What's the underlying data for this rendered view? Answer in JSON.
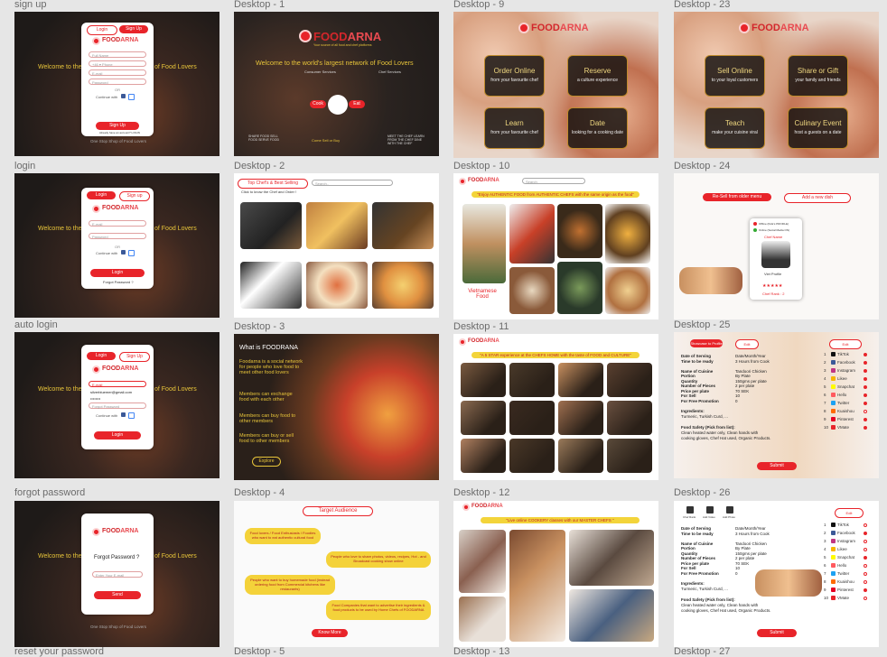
{
  "brand": {
    "name_a": "FOOD",
    "name_b": "ARNA",
    "tagline": "Your source of all food and chef platforms"
  },
  "colors": {
    "accent": "#e8242a",
    "gold": "#e8c53a",
    "canvas": "#e6e6e6"
  },
  "frames": {
    "signup": {
      "label": "sign up",
      "welcome": "Welcome to the",
      "welcome_r": "of Food Lovers",
      "tab_login": "Login",
      "tab_signup": "Sign Up",
      "full_name": "Full Name",
      "phone_code": "+46",
      "phone": "Phone",
      "email": "E-mail",
      "password": "Password",
      "or": "OR",
      "continue_with": "Continue with",
      "submit": "Sign Up",
      "footer": "Already have an account? LOGIN",
      "bottom": "One Stop Shop of Food Lovers"
    },
    "login": {
      "label": "login",
      "welcome": "Welcome to the",
      "welcome_r": "of Food Lovers",
      "tab_login": "Login",
      "tab_signup": "Sign up",
      "email": "E-mail",
      "password": "Password",
      "or": "OR",
      "continue_with": "Continue with",
      "submit": "Login",
      "forgot": "Forgot Password ?"
    },
    "autologin": {
      "label": "auto login",
      "welcome": "Welcome to the",
      "welcome_r": "of Food Lovers",
      "tab_login": "Login",
      "tab_signup": "Sign Up",
      "email_label": "E-mail",
      "email_value": "silverbluemer@gmail.com",
      "password_value": "••••••••",
      "forgot": "Forgot Password",
      "continue_with": "Continue with",
      "submit": "Login"
    },
    "forgot": {
      "label": "forgot password",
      "welcome": "Welcome to the",
      "welcome_r": "of Food Lovers",
      "title": "Forgot Password ?",
      "email": "Enter Your E-mail",
      "submit": "Send",
      "bottom": "One Stop Shop of Food Lovers",
      "next_label": "reset your password"
    },
    "d1": {
      "label": "Desktop - 1",
      "headline": "Welcome to the world's largest network of Food Lovers",
      "select": "Consumer Services",
      "select2": "Chef Services",
      "left_note": "SHARE FOOD SELL FOOD SERVE FOOD",
      "right_note": "MEET THE CHEF LEARN FROM THE CHEF DINE WITH THE CHEF",
      "center_note": "Come Sell or Buy",
      "left_btn": "Cook",
      "right_btn": "Eat"
    },
    "d2": {
      "label": "Desktop - 2",
      "chip": "Top Chef's & Best Selling",
      "search": "Search..",
      "sub": "Click to know the Chef and Order !"
    },
    "d3": {
      "label": "Desktop - 3",
      "title": "What is FOODRANA",
      "p1": "Foodarna is a social network for people who love food to meet other food lovers",
      "p2": "Members can exchange food with each other",
      "p3": "Members can buy food to other members",
      "p4": "Members can buy or sell food to other members",
      "btn": "Explore"
    },
    "d4": {
      "label": "Desktop - 4",
      "title": "Target Audience",
      "b1": "Food lovers / Food Enthusiasts / Foodies who want to eat authentic cultural food",
      "b2": "People who love to share photos, videos, recipes, Hot - and Broadcast cooking show online",
      "b3": "People who want to buy homemade food (instead ordering food from Commercial kitchens like restaurants)",
      "b4": "Food Companies that want to advertise their ingredients & food products to be used by Home Chefs of FOODARNA",
      "btn": "Know More",
      "next_label": "Desktop - 5"
    },
    "d9": {
      "label": "Desktop - 9",
      "tiles": [
        {
          "t": "Order Online",
          "s": "from your favourite chef"
        },
        {
          "t": "Reserve",
          "s": "a culture experience"
        },
        {
          "t": "Learn",
          "s": "from your favourite chef"
        },
        {
          "t": "Date",
          "s": "looking for a cooking date"
        }
      ]
    },
    "d10": {
      "label": "Desktop - 10",
      "banner": "\"Enjoy AUTHENTIC FOOD from AUTHENTIC CHEFS with the same origin as the food\"",
      "caption": "Vietnamese Food",
      "search": "Search"
    },
    "d11": {
      "label": "Desktop - 11",
      "banner": "\"A 5 STAR experience at the CHEFS HOME with the taste of FOOD and CULTURE\""
    },
    "d12": {
      "label": "Desktop - 12",
      "banner": "\"Live online COOKERY classes with our MASTER CHEFS \"",
      "next_label": "Desktop - 13"
    },
    "d23": {
      "label": "Desktop - 23",
      "tiles": [
        {
          "t": "Sell Online",
          "s": "to your loyal customers"
        },
        {
          "t": "Share or Gift",
          "s": "your family and friends"
        },
        {
          "t": "Teach",
          "s": "make your cuisine viral"
        },
        {
          "t": "Culinary Event",
          "s": "host a guests on a date"
        }
      ]
    },
    "d24": {
      "label": "Desktop - 24",
      "btn1": "Re-Sell from older menu",
      "btn2": "Add a new dish",
      "opt1": "Offline (Kids's PROFILE)",
      "opt2": "Online (Social Media ON)",
      "chef_name_label": "Chef Name",
      "chef": "Viet Profile",
      "rank": "Chef Rank : 2"
    },
    "d25": {
      "label": "Desktop - 25",
      "tab1": "Showcase to Profile",
      "tab2": "Edit",
      "tab3": "Edit",
      "form": [
        "Date of Serving",
        "Time to be ready",
        "",
        "Name of Cuisine",
        "Portion",
        "Quantity",
        "Number of Pieces",
        "Price per plate",
        "For Sell",
        "For Free Promotion"
      ],
      "values": [
        "Date/Month/Year",
        "3 Hours from Cook",
        "",
        "Tandoori Chicken",
        "By Plate",
        "150gms per plate",
        "2 per plate",
        "70 SEK",
        "10",
        "0"
      ],
      "ingredients_label": "Ingredients:",
      "ingredients": "Turmeric, Turkish Curd, ...",
      "safety_label": "Food Safety (Pick from list):",
      "safety": "Clean heated water only, Clean hands with cooking gloves, Chef Hat used, Organic Products.",
      "submit": "Submit",
      "social": [
        "TikTok",
        "Facebook",
        "Instagram",
        "Likee",
        "Snapchat",
        "Hello",
        "Twitter",
        "Kuaishou",
        "Pinterest",
        "VMate"
      ]
    },
    "d26": {
      "label": "Desktop - 26",
      "icons": [
        "Chef Rank",
        "Add Video",
        "Add Photo"
      ],
      "edit": "Edit",
      "submit": "Submit",
      "next_label": "Desktop - 27",
      "form": [
        "Date of Serving",
        "Time to be ready",
        "",
        "Name of Cuisine",
        "Portion",
        "Quantity",
        "Number of Pieces",
        "Price per plate",
        "For Sell",
        "For Free Promotion"
      ],
      "values": [
        "Date/Month/Year",
        "3 Hours from Cook",
        "",
        "Tandoori Chicken",
        "By Plate",
        "150gms per plate",
        "2 per plate",
        "70 SEK",
        "10",
        "0"
      ],
      "ingredients_label": "Ingredients:",
      "ingredients": "Turmeric, Turkish Curd, ...",
      "safety_label": "Food Safety (Pick from list):",
      "safety": "Clean heated water only, Clean hands with cooking gloves, Chef Hat used, Organic Products."
    }
  }
}
